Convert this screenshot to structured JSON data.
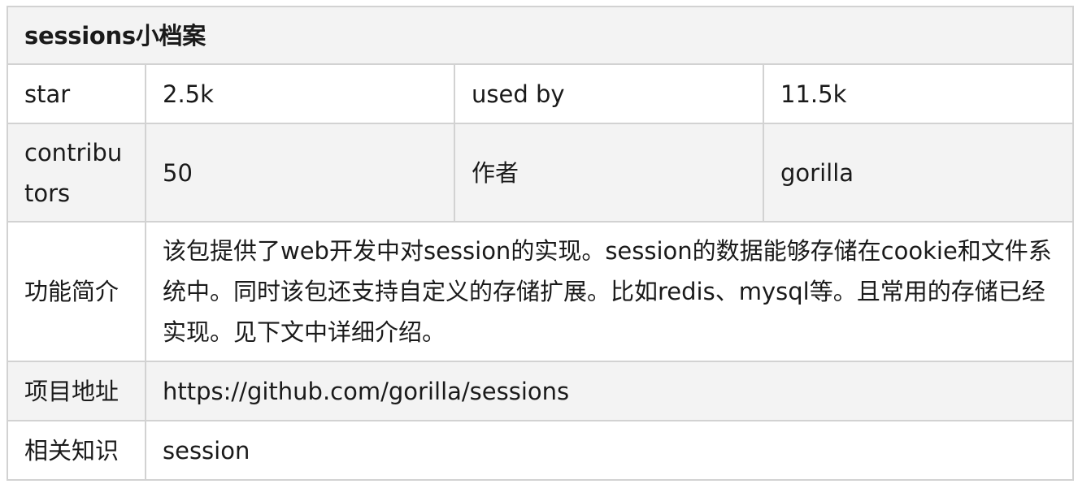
{
  "title": "sessions小档案",
  "rows": {
    "star_label": "star",
    "star_value": "2.5k",
    "used_by_label": "used by",
    "used_by_value": "11.5k",
    "contributors_label": "contributors",
    "contributors_value": "50",
    "author_label": "作者",
    "author_value": "gorilla",
    "description_label": "功能简介",
    "description_value": "该包提供了web开发中对session的实现。session的数据能够存储在cookie和文件系统中。同时该包还支持自定义的存储扩展。比如redis、mysql等。且常用的存储已经实现。见下文中详细介绍。",
    "url_label": "项目地址",
    "url_value": "https://github.com/gorilla/sessions",
    "knowledge_label": "相关知识",
    "knowledge_value": "session"
  },
  "colors": {
    "header_bg": "#f3f3f3",
    "border": "#d2d2d2",
    "text": "#1a1a1a"
  }
}
